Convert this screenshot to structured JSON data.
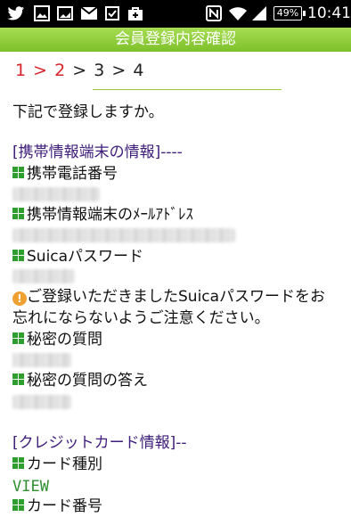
{
  "status_bar": {
    "icons": [
      "twitter-icon",
      "image-icon",
      "gallery-icon",
      "mail-icon",
      "checkbox-icon",
      "bag-icon",
      "nfc-icon",
      "wifi-icon",
      "signal-icon"
    ],
    "battery": "49%",
    "time": "10:41"
  },
  "title": "会員登録内容確認",
  "steps": {
    "s1": "1",
    "sep1": ">",
    "s2": "2",
    "sep2": ">",
    "s3": "3",
    "sep3": ">",
    "s4": "4"
  },
  "intro": "下記で登録しますか。",
  "mobile_section": {
    "heading": "[携帯情報端末の情報]----",
    "phone_label": "携帯電話番号",
    "email_label": "携帯情報端末のﾒｰﾙｱﾄﾞﾚｽ",
    "suica_password_label": "Suicaパスワード",
    "warning_line1": "ご登録いただきましたSuicaパスワードをお",
    "warning_line2": "忘れにならないようご注意ください。",
    "secret_question_label": "秘密の質問",
    "secret_answer_label": "秘密の質問の答え"
  },
  "card_section": {
    "heading": "[クレジットカード情報]--",
    "card_type_label": "カード種別",
    "card_type_value": "VIEW",
    "card_number_label": "カード番号"
  },
  "colors": {
    "title_bar": "#8ccc3a",
    "step_done": "#d9232b",
    "section_heading": "#3e1c7a",
    "marker": "#2e9e2e",
    "card_value": "#2f8f2f"
  }
}
